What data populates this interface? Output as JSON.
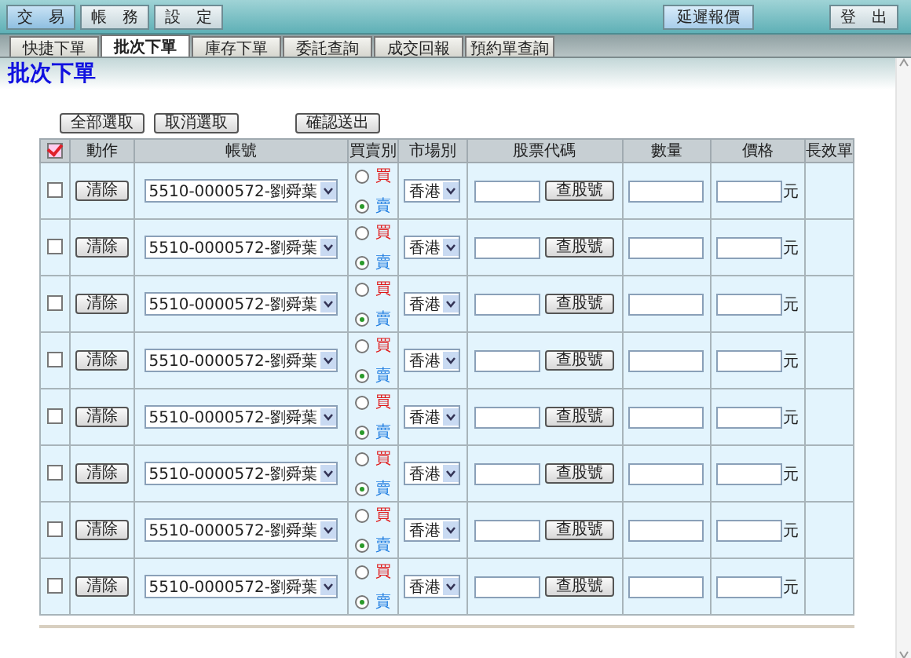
{
  "top_menu": [
    {
      "label": "交　易",
      "selected": true
    },
    {
      "label": "帳　務",
      "selected": false
    },
    {
      "label": "設　定",
      "selected": false
    }
  ],
  "top_right_buttons": [
    "延遲報價",
    "登　出"
  ],
  "tabs": [
    {
      "label": "快捷下單",
      "selected": false
    },
    {
      "label": "批次下單",
      "selected": true
    },
    {
      "label": "庫存下單",
      "selected": false
    },
    {
      "label": "委託查詢",
      "selected": false
    },
    {
      "label": "成交回報",
      "selected": false
    },
    {
      "label": "預約單查詢",
      "selected": false
    }
  ],
  "page_title": "批次下單",
  "actions": [
    "全部選取",
    "取消選取",
    "確認送出"
  ],
  "table": {
    "select_all_checked": true,
    "columns": [
      "動作",
      "帳號",
      "買賣別",
      "市場別",
      "股票代碼",
      "數量",
      "價格",
      "長效單"
    ],
    "rows": [
      {
        "checked": false,
        "clear": "清除",
        "account": "5510-0000572-劉舜葉",
        "sides": [
          {
            "kind": "buy",
            "label": "買",
            "selected": false
          },
          {
            "kind": "sell",
            "label": "賣",
            "selected": true
          }
        ],
        "market": "香港",
        "lookup": "查股號",
        "unit": "元"
      },
      {
        "checked": false,
        "clear": "清除",
        "account": "5510-0000572-劉舜葉",
        "sides": [
          {
            "kind": "buy",
            "label": "買",
            "selected": false
          },
          {
            "kind": "sell",
            "label": "賣",
            "selected": true
          }
        ],
        "market": "香港",
        "lookup": "查股號",
        "unit": "元"
      },
      {
        "checked": false,
        "clear": "清除",
        "account": "5510-0000572-劉舜葉",
        "sides": [
          {
            "kind": "buy",
            "label": "買",
            "selected": false
          },
          {
            "kind": "sell",
            "label": "賣",
            "selected": true
          }
        ],
        "market": "香港",
        "lookup": "查股號",
        "unit": "元"
      },
      {
        "checked": false,
        "clear": "清除",
        "account": "5510-0000572-劉舜葉",
        "sides": [
          {
            "kind": "buy",
            "label": "買",
            "selected": false
          },
          {
            "kind": "sell",
            "label": "賣",
            "selected": true
          }
        ],
        "market": "香港",
        "lookup": "查股號",
        "unit": "元"
      },
      {
        "checked": false,
        "clear": "清除",
        "account": "5510-0000572-劉舜葉",
        "sides": [
          {
            "kind": "buy",
            "label": "買",
            "selected": false
          },
          {
            "kind": "sell",
            "label": "賣",
            "selected": true
          }
        ],
        "market": "香港",
        "lookup": "查股號",
        "unit": "元"
      },
      {
        "checked": false,
        "clear": "清除",
        "account": "5510-0000572-劉舜葉",
        "sides": [
          {
            "kind": "buy",
            "label": "買",
            "selected": false
          },
          {
            "kind": "sell",
            "label": "賣",
            "selected": true
          }
        ],
        "market": "香港",
        "lookup": "查股號",
        "unit": "元"
      },
      {
        "checked": false,
        "clear": "清除",
        "account": "5510-0000572-劉舜葉",
        "sides": [
          {
            "kind": "buy",
            "label": "買",
            "selected": false
          },
          {
            "kind": "sell",
            "label": "賣",
            "selected": true
          }
        ],
        "market": "香港",
        "lookup": "查股號",
        "unit": "元"
      },
      {
        "checked": false,
        "clear": "清除",
        "account": "5510-0000572-劉舜葉",
        "sides": [
          {
            "kind": "buy",
            "label": "買",
            "selected": false
          },
          {
            "kind": "sell",
            "label": "賣",
            "selected": true
          }
        ],
        "market": "香港",
        "lookup": "查股號",
        "unit": "元"
      }
    ]
  }
}
